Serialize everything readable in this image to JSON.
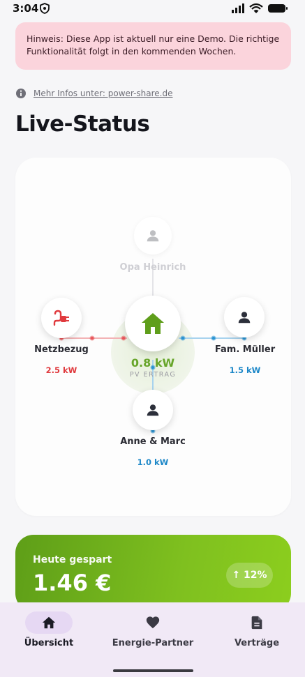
{
  "status_bar": {
    "time": "3:04"
  },
  "banner": {
    "text": "Hinweis: Diese App ist aktuell nur eine Demo. Die richtige Funktionalität folgt in den kommenden Wochen."
  },
  "info": {
    "link_text": "Mehr Infos unter: power-share.de"
  },
  "page_title": "Live-Status",
  "flow": {
    "top": {
      "label": "Opa Heinrich"
    },
    "left": {
      "label": "Netzbezug",
      "value": "2.5 kW"
    },
    "center": {
      "value": "0.8 kW",
      "label": "PV ERTRAG"
    },
    "right": {
      "label": "Fam. Müller",
      "value": "1.5 kW"
    },
    "bottom": {
      "label": "Anne & Marc",
      "value": "1.0 kW"
    }
  },
  "savings": {
    "label": "Heute gespart",
    "value": "1.46 €",
    "badge": "↑ 12%"
  },
  "nav": {
    "items": [
      {
        "label": "Übersicht",
        "icon": "home-icon",
        "active": true
      },
      {
        "label": "Energie-Partner",
        "icon": "heart-icon",
        "active": false
      },
      {
        "label": "Verträge",
        "icon": "document-icon",
        "active": false
      }
    ]
  },
  "colors": {
    "accent_green": "#67a52a",
    "grid_red": "#e03a3e",
    "partner_blue": "#1e88c8",
    "banner_bg": "#fbd4dc",
    "nav_bg": "#f1e9f6"
  }
}
